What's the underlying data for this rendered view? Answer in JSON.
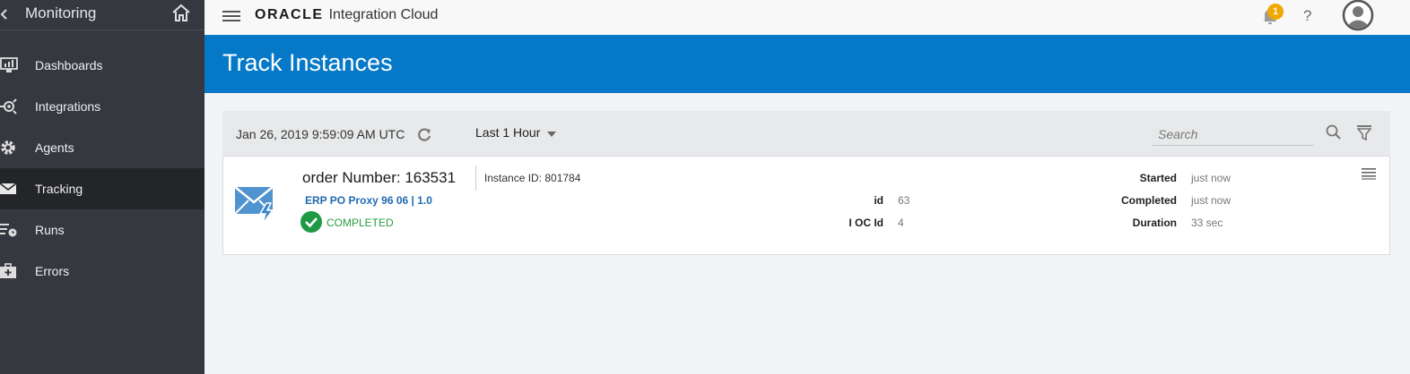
{
  "sidebar": {
    "title": "Monitoring",
    "items": [
      {
        "label": "Dashboards",
        "icon": "dashboard-icon",
        "active": false
      },
      {
        "label": "Integrations",
        "icon": "integrations-icon",
        "active": false
      },
      {
        "label": "Agents",
        "icon": "gear-icon",
        "active": false
      },
      {
        "label": "Tracking",
        "icon": "envelope-icon",
        "active": true
      },
      {
        "label": "Runs",
        "icon": "runs-icon",
        "active": false
      },
      {
        "label": "Errors",
        "icon": "errors-icon",
        "active": false
      }
    ]
  },
  "topbar": {
    "brand": "ORACLE",
    "product": "Integration Cloud",
    "notification_count": "1",
    "help": "?"
  },
  "page": {
    "title": "Track Instances"
  },
  "filter": {
    "datetime": "Jan 26, 2019 9:59:09 AM UTC",
    "range": "Last 1 Hour",
    "search_placeholder": "Search"
  },
  "instance": {
    "order": "order Number: 163531",
    "instance_id": "Instance ID: 801784",
    "integration": "ERP PO Proxy 96 06 | 1.0",
    "status": "COMPLETED",
    "fields": {
      "id_label": "id",
      "id_value": "63",
      "ioc_label": "I OC Id",
      "ioc_value": "4",
      "started_label": "Started",
      "started_value": "just now",
      "completed_label": "Completed",
      "completed_value": "just now",
      "duration_label": "Duration",
      "duration_value": "33 sec"
    }
  },
  "colors": {
    "sidebar_bg": "#363840",
    "sidebar_active": "#232529",
    "header_blue": "#0579c8",
    "status_green": "#27a040",
    "link_blue": "#1f6bb0",
    "badge_orange": "#f0a800"
  }
}
